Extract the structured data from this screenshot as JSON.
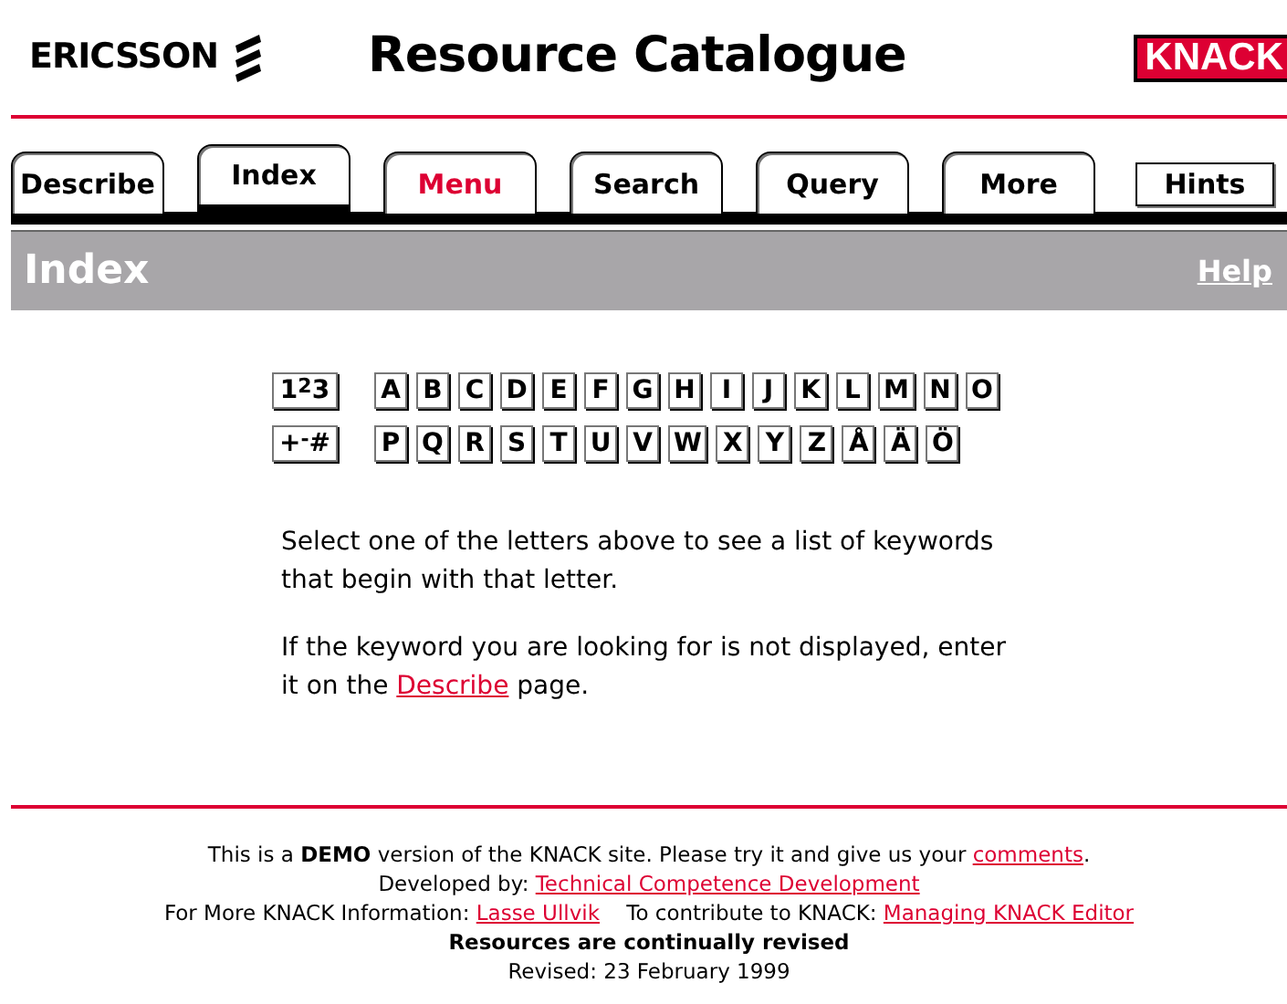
{
  "header": {
    "logo": "ERICSSON",
    "title": "Resource Catalogue",
    "badge": "KNACK"
  },
  "tabs": [
    {
      "label": "Describe",
      "kind": "tab",
      "selected": false,
      "color": "#000000"
    },
    {
      "label": "Index",
      "kind": "tab",
      "selected": true,
      "color": "#000000"
    },
    {
      "label": "Menu",
      "kind": "tab",
      "selected": false,
      "color": "#dd0033"
    },
    {
      "label": "Search",
      "kind": "tab",
      "selected": false,
      "color": "#000000"
    },
    {
      "label": "Query",
      "kind": "tab",
      "selected": false,
      "color": "#000000"
    },
    {
      "label": "More",
      "kind": "tab",
      "selected": false,
      "color": "#000000"
    },
    {
      "label": "Hints",
      "kind": "button",
      "color": "#000000"
    }
  ],
  "section": {
    "title": "Index",
    "help": "Help"
  },
  "key_rows": [
    [
      "1$^{2}$3",
      "A",
      "B",
      "C",
      "D",
      "E",
      "F",
      "G",
      "H",
      "I",
      "J",
      "K",
      "L",
      "M",
      "N",
      "O"
    ],
    [
      "+$^{-}$#",
      "P",
      "Q",
      "R",
      "S",
      "T",
      "U",
      "V",
      "W",
      "X",
      "Y",
      "Z",
      "Å",
      "Ä",
      "Ö"
    ]
  ],
  "paragraphs": [
    [
      {
        "text": "Select one of the letters above to see a list of keywords that begin with that letter."
      }
    ],
    [
      {
        "text": "If the keyword you are looking for is not displayed, enter it on the "
      },
      {
        "link": "Describe"
      },
      {
        "text": " page."
      }
    ]
  ],
  "footer": [
    {
      "kind": "line",
      "parts": [
        {
          "text": "This is a **DEMO** version of the KNACK site. Please try it and give us your "
        },
        {
          "link": "comments"
        },
        {
          "text": "."
        }
      ]
    },
    {
      "kind": "line",
      "parts": [
        {
          "text": "Developed by: "
        },
        {
          "link": "Technical Competence Development"
        }
      ]
    },
    {
      "kind": "line",
      "parts": [
        {
          "text": "For More KNACK Information: "
        },
        {
          "link": "Lasse Ullvik"
        },
        {
          "text": "    To contribute to KNACK: "
        },
        {
          "link": "Managing KNACK Editor"
        }
      ]
    },
    {
      "kind": "bold",
      "parts": [
        {
          "text": "Resources are continually revised"
        }
      ]
    },
    {
      "kind": "line",
      "parts": [
        {
          "text": "Revised: 23 February 1999"
        }
      ]
    }
  ]
}
